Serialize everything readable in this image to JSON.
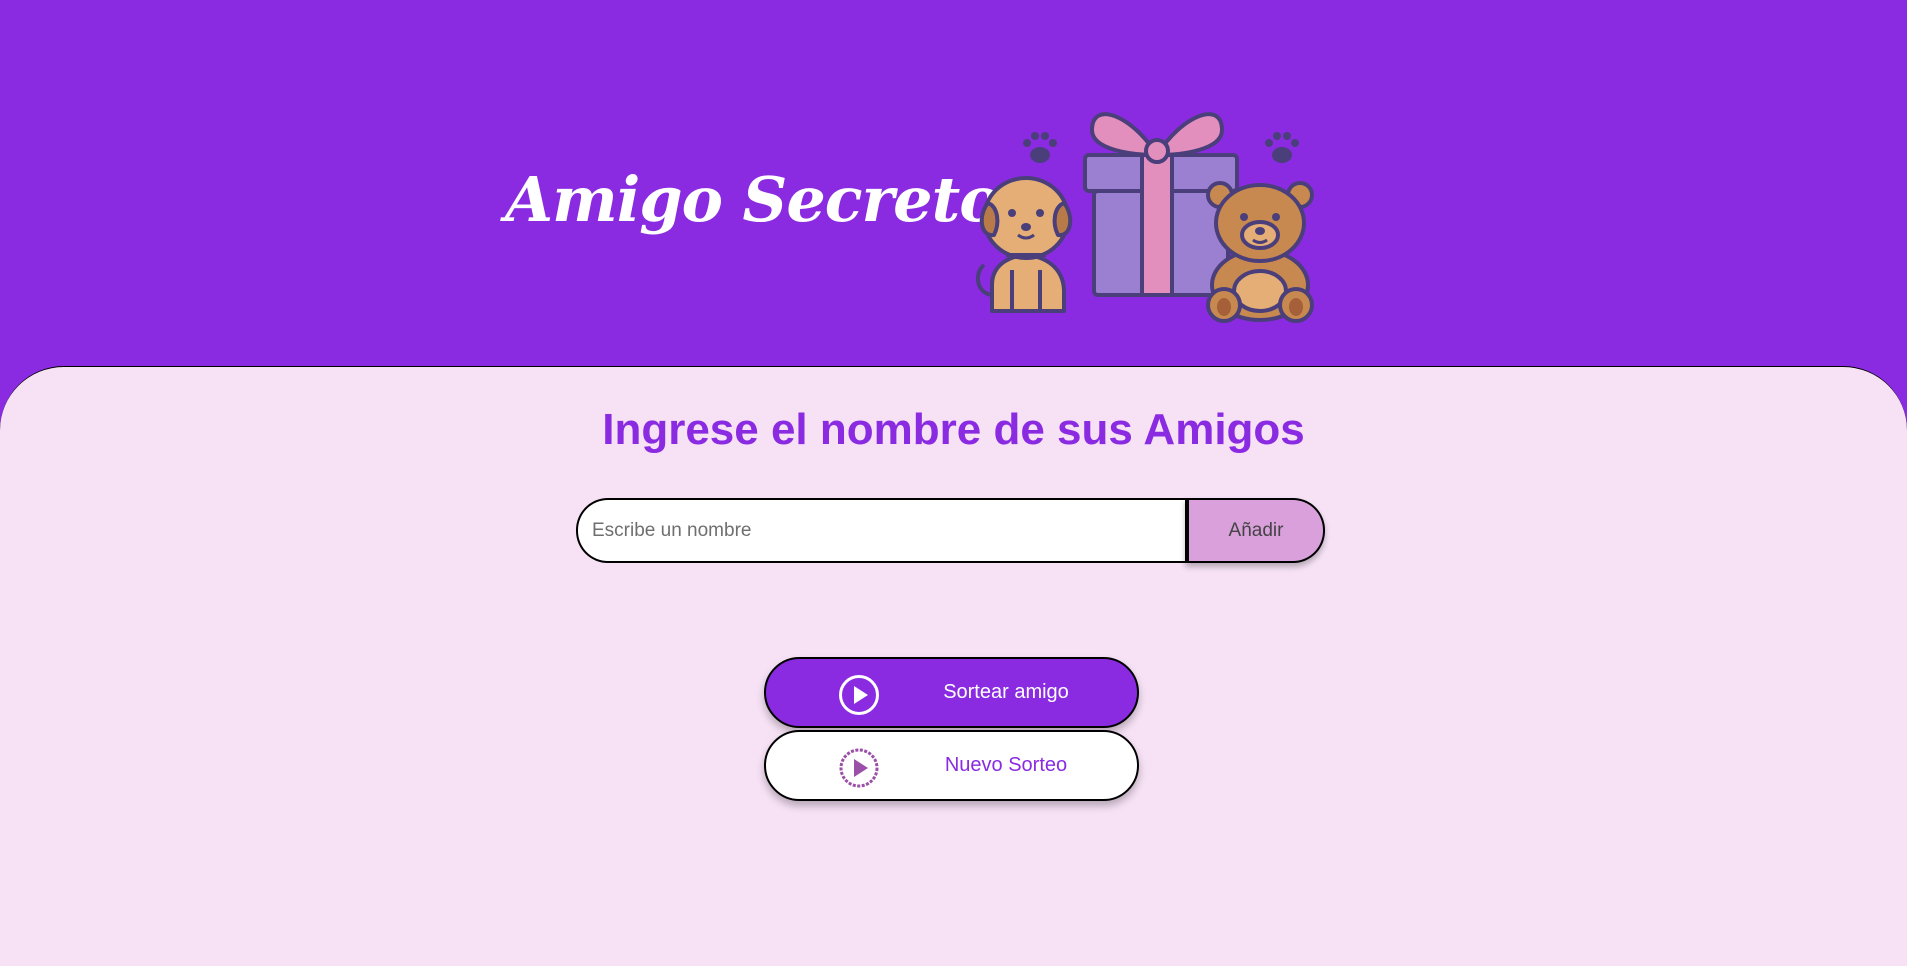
{
  "header": {
    "title": "Amigo Secreto",
    "illustration_icon": "gift-puppy-bear-illustration"
  },
  "main": {
    "subtitle": "Ingrese el nombre de sus Amigos",
    "input": {
      "placeholder": "Escribe un nombre",
      "value": ""
    },
    "add_button_label": "Añadir",
    "draw_button": {
      "label": "Sortear amigo",
      "icon": "play-circle-icon"
    },
    "reset_button": {
      "label": "Nuevo Sorteo",
      "icon": "play-circle-icon"
    }
  },
  "colors": {
    "primary": "#8a2be2",
    "background": "#f6e1f5",
    "add_button": "#d9a0dc",
    "gift_box": "#9b7fd0",
    "ribbon": "#e38fbd"
  }
}
